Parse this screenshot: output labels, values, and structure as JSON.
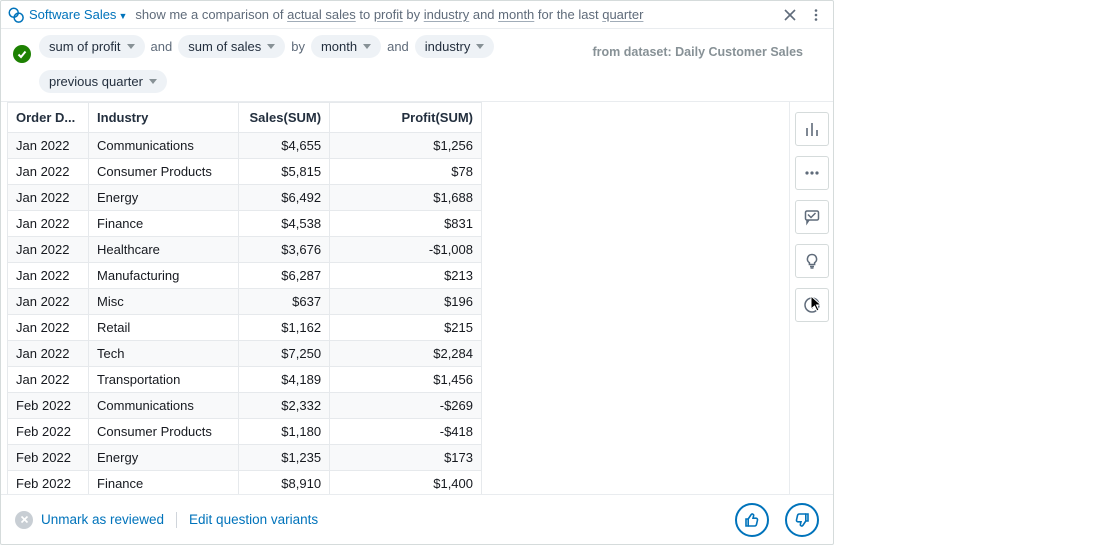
{
  "query_bar": {
    "topic": "Software Sales",
    "query_parts": {
      "p0": "show me a comparison of ",
      "u0": "actual sales",
      "p1": " to ",
      "u1": "profit",
      "p2": " by ",
      "u2": "industry",
      "p3": " and ",
      "u3": "month",
      "p4": " for the last ",
      "u4": "quarter"
    },
    "close_icon": "close-icon",
    "kebab_icon": "kebab-icon"
  },
  "interp": {
    "status_icon": "check-icon",
    "pills": {
      "p0": "sum of profit",
      "w0": "and",
      "p1": "sum of sales",
      "w1": "by",
      "p2": "month",
      "w2": "and",
      "p3": "industry",
      "p4": "previous quarter"
    },
    "dataset_label": "from dataset: Daily Customer Sales"
  },
  "table": {
    "columns": {
      "c0": "Order D...",
      "c1": "Industry",
      "c2": "Sales(SUM)",
      "c3": "Profit(SUM)"
    },
    "rows": [
      {
        "d": "Jan 2022",
        "i": "Communications",
        "s": "$4,655",
        "p": "$1,256"
      },
      {
        "d": "Jan 2022",
        "i": "Consumer Products",
        "s": "$5,815",
        "p": "$78"
      },
      {
        "d": "Jan 2022",
        "i": "Energy",
        "s": "$6,492",
        "p": "$1,688"
      },
      {
        "d": "Jan 2022",
        "i": "Finance",
        "s": "$4,538",
        "p": "$831"
      },
      {
        "d": "Jan 2022",
        "i": "Healthcare",
        "s": "$3,676",
        "p": "-$1,008"
      },
      {
        "d": "Jan 2022",
        "i": "Manufacturing",
        "s": "$6,287",
        "p": "$213"
      },
      {
        "d": "Jan 2022",
        "i": "Misc",
        "s": "$637",
        "p": "$196"
      },
      {
        "d": "Jan 2022",
        "i": "Retail",
        "s": "$1,162",
        "p": "$215"
      },
      {
        "d": "Jan 2022",
        "i": "Tech",
        "s": "$7,250",
        "p": "$2,284"
      },
      {
        "d": "Jan 2022",
        "i": "Transportation",
        "s": "$4,189",
        "p": "$1,456"
      },
      {
        "d": "Feb 2022",
        "i": "Communications",
        "s": "$2,332",
        "p": "-$269"
      },
      {
        "d": "Feb 2022",
        "i": "Consumer Products",
        "s": "$1,180",
        "p": "-$418"
      },
      {
        "d": "Feb 2022",
        "i": "Energy",
        "s": "$1,235",
        "p": "$173"
      },
      {
        "d": "Feb 2022",
        "i": "Finance",
        "s": "$8,910",
        "p": "$1,400"
      }
    ]
  },
  "rail_icons": {
    "i0": "bar-chart-icon",
    "i1": "more-icon",
    "i2": "feedback-icon",
    "i3": "lightbulb-icon",
    "i4": "info-icon"
  },
  "footer": {
    "link0": "Unmark as reviewed",
    "link1": "Edit question variants",
    "thumb_up": "thumbs-up-icon",
    "thumb_down": "thumbs-down-icon"
  }
}
